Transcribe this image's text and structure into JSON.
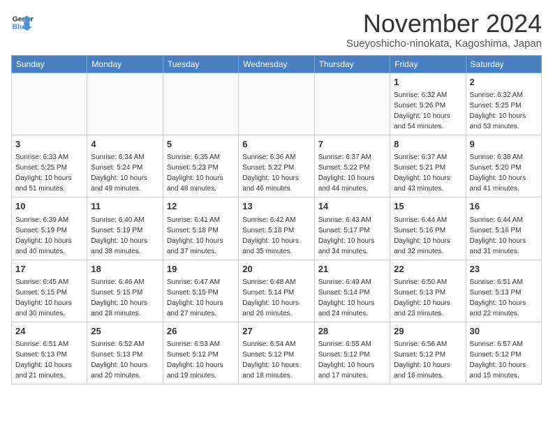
{
  "header": {
    "logo_line1": "General",
    "logo_line2": "Blue",
    "month": "November 2024",
    "location": "Sueyoshicho-ninokata, Kagoshima, Japan"
  },
  "weekdays": [
    "Sunday",
    "Monday",
    "Tuesday",
    "Wednesday",
    "Thursday",
    "Friday",
    "Saturday"
  ],
  "weeks": [
    [
      {
        "day": "",
        "info": ""
      },
      {
        "day": "",
        "info": ""
      },
      {
        "day": "",
        "info": ""
      },
      {
        "day": "",
        "info": ""
      },
      {
        "day": "",
        "info": ""
      },
      {
        "day": "1",
        "info": "Sunrise: 6:32 AM\nSunset: 5:26 PM\nDaylight: 10 hours\nand 54 minutes."
      },
      {
        "day": "2",
        "info": "Sunrise: 6:32 AM\nSunset: 5:25 PM\nDaylight: 10 hours\nand 53 minutes."
      }
    ],
    [
      {
        "day": "3",
        "info": "Sunrise: 6:33 AM\nSunset: 5:25 PM\nDaylight: 10 hours\nand 51 minutes."
      },
      {
        "day": "4",
        "info": "Sunrise: 6:34 AM\nSunset: 5:24 PM\nDaylight: 10 hours\nand 49 minutes."
      },
      {
        "day": "5",
        "info": "Sunrise: 6:35 AM\nSunset: 5:23 PM\nDaylight: 10 hours\nand 48 minutes."
      },
      {
        "day": "6",
        "info": "Sunrise: 6:36 AM\nSunset: 5:22 PM\nDaylight: 10 hours\nand 46 minutes."
      },
      {
        "day": "7",
        "info": "Sunrise: 6:37 AM\nSunset: 5:22 PM\nDaylight: 10 hours\nand 44 minutes."
      },
      {
        "day": "8",
        "info": "Sunrise: 6:37 AM\nSunset: 5:21 PM\nDaylight: 10 hours\nand 43 minutes."
      },
      {
        "day": "9",
        "info": "Sunrise: 6:38 AM\nSunset: 5:20 PM\nDaylight: 10 hours\nand 41 minutes."
      }
    ],
    [
      {
        "day": "10",
        "info": "Sunrise: 6:39 AM\nSunset: 5:19 PM\nDaylight: 10 hours\nand 40 minutes."
      },
      {
        "day": "11",
        "info": "Sunrise: 6:40 AM\nSunset: 5:19 PM\nDaylight: 10 hours\nand 38 minutes."
      },
      {
        "day": "12",
        "info": "Sunrise: 6:41 AM\nSunset: 5:18 PM\nDaylight: 10 hours\nand 37 minutes."
      },
      {
        "day": "13",
        "info": "Sunrise: 6:42 AM\nSunset: 5:18 PM\nDaylight: 10 hours\nand 35 minutes."
      },
      {
        "day": "14",
        "info": "Sunrise: 6:43 AM\nSunset: 5:17 PM\nDaylight: 10 hours\nand 34 minutes."
      },
      {
        "day": "15",
        "info": "Sunrise: 6:44 AM\nSunset: 5:16 PM\nDaylight: 10 hours\nand 32 minutes."
      },
      {
        "day": "16",
        "info": "Sunrise: 6:44 AM\nSunset: 5:16 PM\nDaylight: 10 hours\nand 31 minutes."
      }
    ],
    [
      {
        "day": "17",
        "info": "Sunrise: 6:45 AM\nSunset: 5:15 PM\nDaylight: 10 hours\nand 30 minutes."
      },
      {
        "day": "18",
        "info": "Sunrise: 6:46 AM\nSunset: 5:15 PM\nDaylight: 10 hours\nand 28 minutes."
      },
      {
        "day": "19",
        "info": "Sunrise: 6:47 AM\nSunset: 5:15 PM\nDaylight: 10 hours\nand 27 minutes."
      },
      {
        "day": "20",
        "info": "Sunrise: 6:48 AM\nSunset: 5:14 PM\nDaylight: 10 hours\nand 26 minutes."
      },
      {
        "day": "21",
        "info": "Sunrise: 6:49 AM\nSunset: 5:14 PM\nDaylight: 10 hours\nand 24 minutes."
      },
      {
        "day": "22",
        "info": "Sunrise: 6:50 AM\nSunset: 5:13 PM\nDaylight: 10 hours\nand 23 minutes."
      },
      {
        "day": "23",
        "info": "Sunrise: 6:51 AM\nSunset: 5:13 PM\nDaylight: 10 hours\nand 22 minutes."
      }
    ],
    [
      {
        "day": "24",
        "info": "Sunrise: 6:51 AM\nSunset: 5:13 PM\nDaylight: 10 hours\nand 21 minutes."
      },
      {
        "day": "25",
        "info": "Sunrise: 6:52 AM\nSunset: 5:13 PM\nDaylight: 10 hours\nand 20 minutes."
      },
      {
        "day": "26",
        "info": "Sunrise: 6:53 AM\nSunset: 5:12 PM\nDaylight: 10 hours\nand 19 minutes."
      },
      {
        "day": "27",
        "info": "Sunrise: 6:54 AM\nSunset: 5:12 PM\nDaylight: 10 hours\nand 18 minutes."
      },
      {
        "day": "28",
        "info": "Sunrise: 6:55 AM\nSunset: 5:12 PM\nDaylight: 10 hours\nand 17 minutes."
      },
      {
        "day": "29",
        "info": "Sunrise: 6:56 AM\nSunset: 5:12 PM\nDaylight: 10 hours\nand 16 minutes."
      },
      {
        "day": "30",
        "info": "Sunrise: 6:57 AM\nSunset: 5:12 PM\nDaylight: 10 hours\nand 15 minutes."
      }
    ]
  ]
}
